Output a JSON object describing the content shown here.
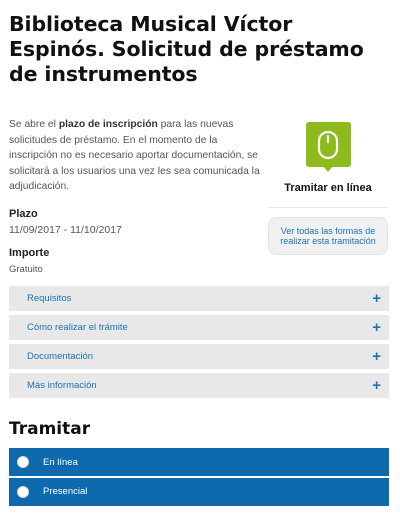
{
  "page": {
    "title": "Biblioteca Musical Víctor Espinós. Solicitud de préstamo de instrumentos",
    "intro": {
      "part1": "Se abre el ",
      "bold": "plazo de inscripción",
      "part2": " para las nuevas solicitudes de préstamo. En el momento de la inscripción no es necesario aportar documentación, se solicitará a los usuarios una vez les sea comunicada la adjudicación."
    }
  },
  "details": {
    "plazo_label": "Plazo",
    "plazo_value": "11/09/2017 - 11/10/2017",
    "importe_label": "Importe",
    "importe_value": "Gratuito"
  },
  "sidebar": {
    "icon": "mouse-icon",
    "accent_color": "#8dba1c",
    "tramitar_label": "Tramitar en línea",
    "forms_button_label": "Ver todas las formas de realizar esta tramitación"
  },
  "accordion": [
    {
      "label": "Requisitos",
      "icon": "plus-icon"
    },
    {
      "label": "Cómo realizar el trámite",
      "icon": "plus-icon"
    },
    {
      "label": "Documentación",
      "icon": "plus-icon"
    },
    {
      "label": "Más información",
      "icon": "plus-icon"
    }
  ],
  "tramitar": {
    "heading": "Tramitar",
    "options_color": "#0f6aad",
    "options": [
      {
        "label": "En línea"
      },
      {
        "label": "Presencial"
      }
    ]
  }
}
